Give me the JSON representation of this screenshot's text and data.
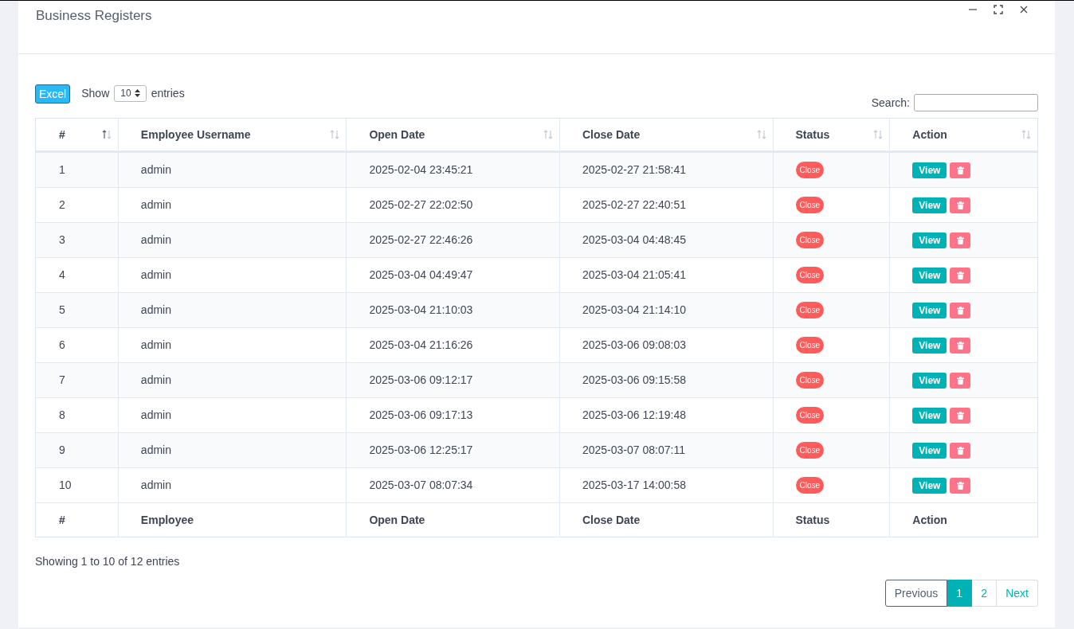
{
  "window": {
    "title": "Business Registers"
  },
  "toolbar": {
    "export_button": "Excel",
    "show_label": "Show",
    "page_size": "10",
    "entries_label": "entries",
    "search_label": "Search:"
  },
  "table": {
    "columns": [
      {
        "label": "#",
        "sorted": true
      },
      {
        "label": "Employee Username",
        "sorted": false
      },
      {
        "label": "Open Date",
        "sorted": false
      },
      {
        "label": "Close Date",
        "sorted": false
      },
      {
        "label": "Status",
        "sorted": false
      },
      {
        "label": "Action",
        "sorted": false
      }
    ],
    "rows": [
      {
        "n": "1",
        "user": "admin",
        "open": "2025-02-04 23:45:21",
        "close": "2025-02-27 21:58:41",
        "status": "Close",
        "action": "View"
      },
      {
        "n": "2",
        "user": "admin",
        "open": "2025-02-27 22:02:50",
        "close": "2025-02-27 22:40:51",
        "status": "Close",
        "action": "View"
      },
      {
        "n": "3",
        "user": "admin",
        "open": "2025-02-27 22:46:26",
        "close": "2025-03-04 04:48:45",
        "status": "Close",
        "action": "View"
      },
      {
        "n": "4",
        "user": "admin",
        "open": "2025-03-04 04:49:47",
        "close": "2025-03-04 21:05:41",
        "status": "Close",
        "action": "View"
      },
      {
        "n": "5",
        "user": "admin",
        "open": "2025-03-04 21:10:03",
        "close": "2025-03-04 21:14:10",
        "status": "Close",
        "action": "View"
      },
      {
        "n": "6",
        "user": "admin",
        "open": "2025-03-04 21:16:26",
        "close": "2025-03-06 09:08:03",
        "status": "Close",
        "action": "View"
      },
      {
        "n": "7",
        "user": "admin",
        "open": "2025-03-06 09:12:17",
        "close": "2025-03-06 09:15:58",
        "status": "Close",
        "action": "View"
      },
      {
        "n": "8",
        "user": "admin",
        "open": "2025-03-06 09:17:13",
        "close": "2025-03-06 12:19:48",
        "status": "Close",
        "action": "View"
      },
      {
        "n": "9",
        "user": "admin",
        "open": "2025-03-06 12:25:17",
        "close": "2025-03-07 08:07:11",
        "status": "Close",
        "action": "View"
      },
      {
        "n": "10",
        "user": "admin",
        "open": "2025-03-07 08:07:34",
        "close": "2025-03-17 14:00:58",
        "status": "Close",
        "action": "View"
      }
    ],
    "footer": [
      "#",
      "Employee",
      "Open Date",
      "Close Date",
      "Status",
      "Action"
    ]
  },
  "info": "Showing 1 to 10 of 12 entries",
  "pagination": {
    "previous": {
      "label": "Previous",
      "disabled": true
    },
    "pages": [
      {
        "label": "1",
        "selected": true
      },
      {
        "label": "2",
        "selected": false
      }
    ],
    "next": {
      "label": "Next",
      "disabled": false
    }
  }
}
